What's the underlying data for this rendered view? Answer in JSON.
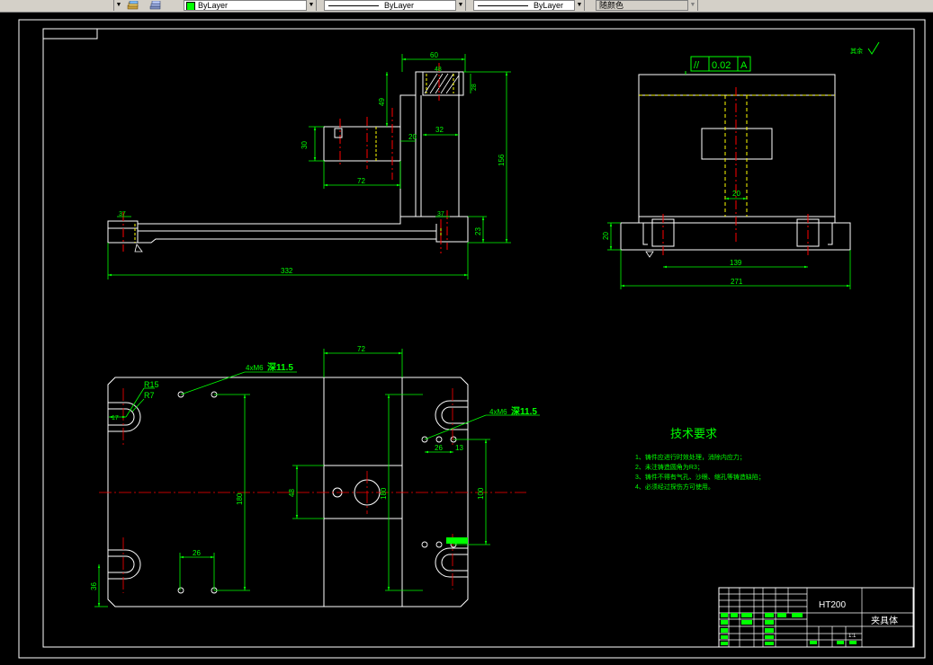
{
  "toolbar": {
    "color_label": "ByLayer",
    "linetype_label": "ByLayer",
    "lineweight_label": "ByLayer",
    "plotstyle_label": "随颜色",
    "layer_icon": "layer-stack-icon",
    "dropdown_icon": "chevron-down-icon"
  },
  "colors": {
    "background": "#000000",
    "outline": "#ffffff",
    "dimension": "#00ff00",
    "centerline": "#ff0000",
    "hidden": "#ffff00",
    "toolbar": "#d4d0c8"
  },
  "front_view": {
    "dim_60": "60",
    "dim_49": "49",
    "dim_30": "30",
    "dim_20": "20",
    "dim_32": "32",
    "dim_72": "72",
    "dim_156": "156",
    "dim_23": "23",
    "dim_332": "332",
    "dim_37": "37",
    "dim_48": "48",
    "dim_28": "28"
  },
  "side_view": {
    "tolerance_symbol": "//",
    "tolerance_value": "0.02",
    "datum": "A",
    "dim_20_width": "20",
    "dim_20_height": "20",
    "dim_139": "139",
    "dim_271": "271",
    "roughness_label": "其余"
  },
  "top_view": {
    "thread_note_1": "4xM6",
    "depth_note_1": "深11.5",
    "thread_note_2": "4xM6",
    "depth_note_2": "深11.5",
    "r15": "R15",
    "r7": "R7",
    "dim_17": "17",
    "dim_72": "72",
    "dim_180_left": "180",
    "dim_48": "48",
    "dim_180_right": "180",
    "dim_100": "100",
    "dim_26_right": "26",
    "dim_13": "13",
    "dim_26_bottom": "26",
    "dim_36": "36"
  },
  "tech_req": {
    "title": "技术要求",
    "items": [
      "1、铸件应进行时效处理，消除内应力；",
      "2、未注铸造圆角为R3；",
      "3、铸件不得有气孔、沙眼、缩孔等铸造缺陷；",
      "4、必须经过探伤方可使用。"
    ]
  },
  "title_block": {
    "material": "HT200",
    "part_name": "夹具体",
    "scale": "1:1"
  }
}
